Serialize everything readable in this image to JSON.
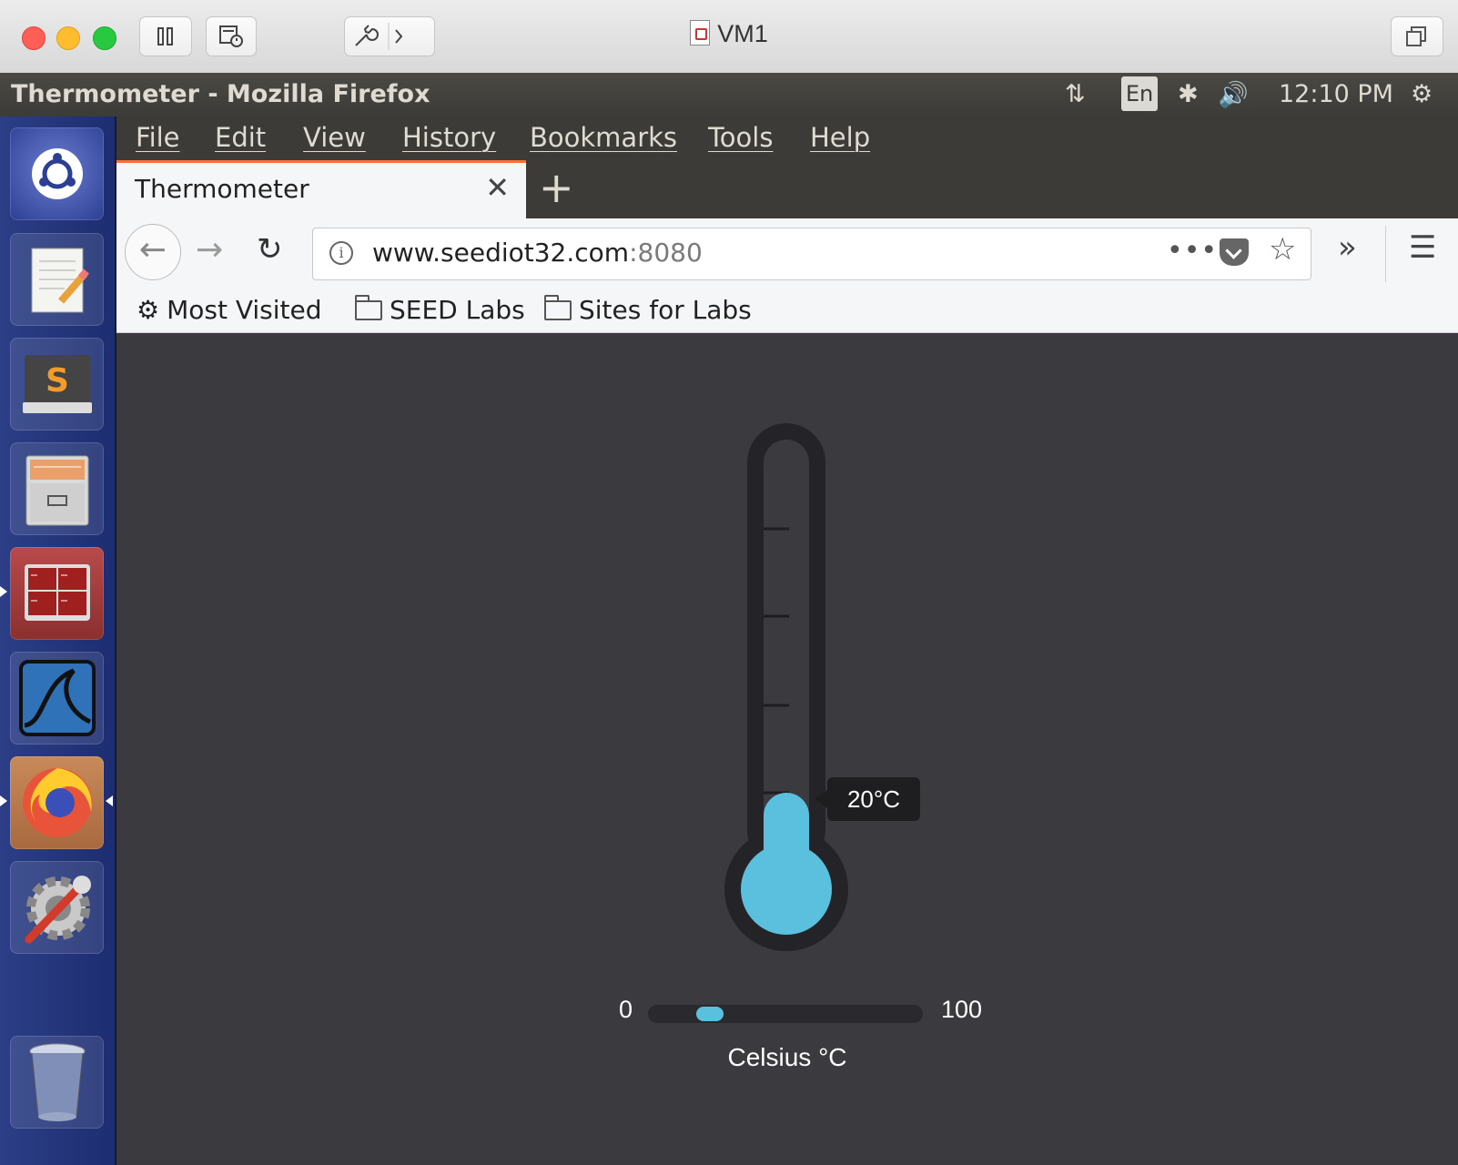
{
  "host_window": {
    "title": "VM1"
  },
  "ubuntu_panel": {
    "window_title": "Thermometer - Mozilla Firefox",
    "language": "En",
    "clock": "12:10 PM"
  },
  "firefox": {
    "menu": [
      "File",
      "Edit",
      "View",
      "History",
      "Bookmarks",
      "Tools",
      "Help"
    ],
    "tab_title": "Thermometer",
    "url_host": "www.seediot32.com",
    "url_port": ":8080",
    "bookmarks": [
      "Most Visited",
      "SEED Labs",
      "Sites for Labs"
    ]
  },
  "thermometer": {
    "value": 20,
    "tooltip": "20°C",
    "min_label": "0",
    "max_label": "100",
    "unit_label": "Celsius °C",
    "fill_color": "#5bc0de",
    "background_color": "#3a3a3f"
  }
}
